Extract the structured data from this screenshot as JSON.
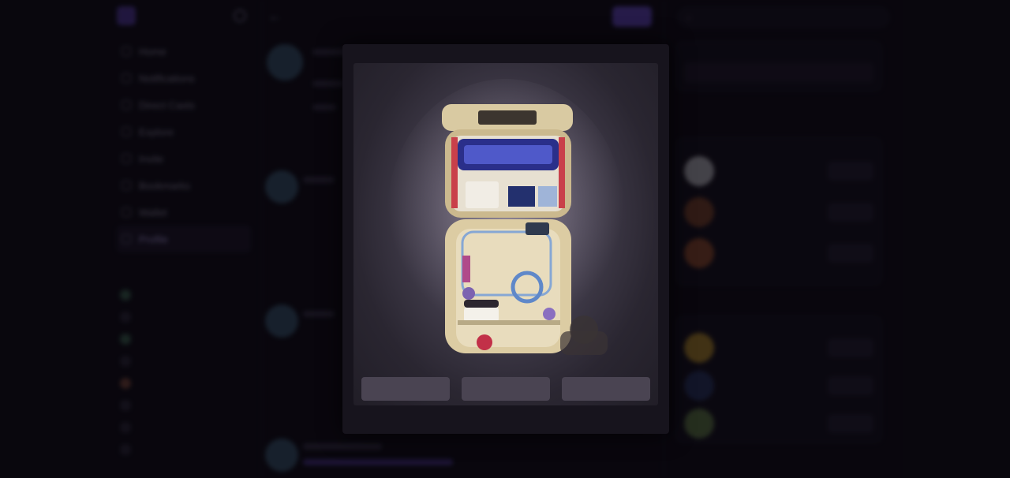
{
  "sidebar": {
    "nav": [
      {
        "label": "Home",
        "icon": "home-icon"
      },
      {
        "label": "Notifications",
        "icon": "bell-icon"
      },
      {
        "label": "Direct Casts",
        "icon": "envelope-icon"
      },
      {
        "label": "Explore",
        "icon": "search-icon"
      },
      {
        "label": "Invite",
        "icon": "user-plus-icon"
      },
      {
        "label": "Bookmarks",
        "icon": "bookmark-icon"
      },
      {
        "label": "Wallet",
        "icon": "wallet-icon"
      },
      {
        "label": "Profile",
        "icon": "profile-icon"
      }
    ],
    "section_label": "",
    "channels": [
      {
        "label": ""
      },
      {
        "label": ""
      },
      {
        "label": ""
      },
      {
        "label": ""
      },
      {
        "label": ""
      },
      {
        "label": ""
      },
      {
        "label": ""
      },
      {
        "label": ""
      }
    ],
    "create_channel": ""
  },
  "feed": {
    "title": "",
    "cta": "",
    "tab": ""
  },
  "right": {
    "search_placeholder": "",
    "invite_card": {
      "title": "",
      "text": "",
      "button": ""
    },
    "suggested_follows": {
      "title": "",
      "people": [
        {
          "name": "",
          "handle": "",
          "button": ""
        },
        {
          "name": "",
          "handle": "",
          "button": ""
        },
        {
          "name": "",
          "handle": "",
          "button": ""
        }
      ],
      "show_more": ""
    },
    "suggested_channels": {
      "title": "",
      "channels": [
        {
          "name": "",
          "meta": "",
          "button": ""
        },
        {
          "name": "",
          "meta": "",
          "button": ""
        },
        {
          "name": "",
          "meta": "",
          "button": ""
        }
      ]
    }
  },
  "modal": {
    "machine_sign": "",
    "choices": [
      "",
      "",
      ""
    ],
    "caption": ""
  },
  "colors": {
    "accent": "#6d4fd6",
    "background": "#0b0910",
    "modal": "#17141d"
  }
}
